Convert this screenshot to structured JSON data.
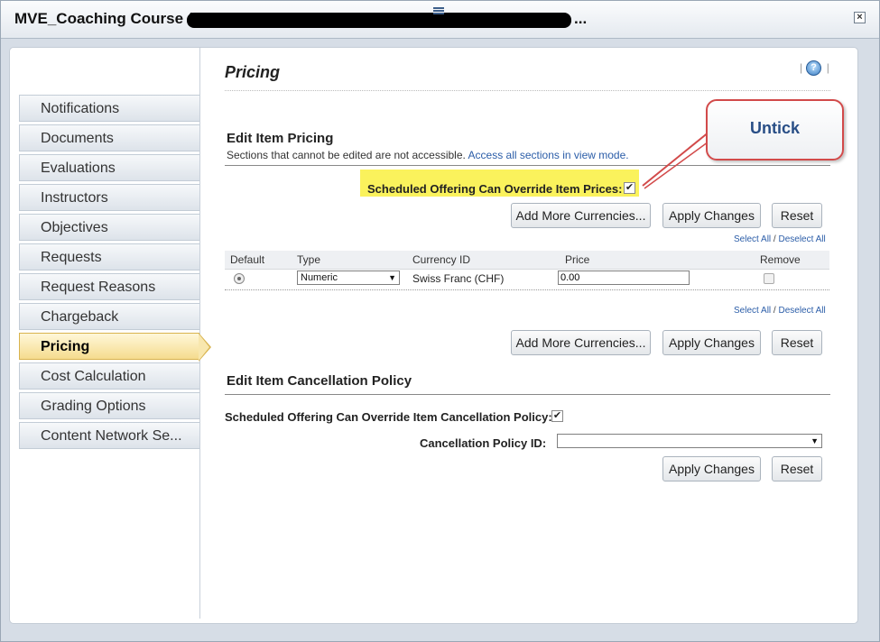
{
  "window": {
    "title": "MVE_Coaching Course (",
    "title_suffix": "...",
    "close_glyph": "×"
  },
  "sidebar": {
    "items": [
      {
        "label": "Notifications"
      },
      {
        "label": "Documents"
      },
      {
        "label": "Evaluations"
      },
      {
        "label": "Instructors"
      },
      {
        "label": "Objectives"
      },
      {
        "label": "Requests"
      },
      {
        "label": "Request Reasons"
      },
      {
        "label": "Chargeback"
      },
      {
        "label": "Pricing",
        "active": true
      },
      {
        "label": "Cost Calculation"
      },
      {
        "label": "Grading Options"
      },
      {
        "label": "Content Network Se..."
      }
    ]
  },
  "page": {
    "heading": "Pricing",
    "help_glyph": "?"
  },
  "item_pricing": {
    "title": "Edit Item Pricing",
    "note": "Sections that cannot be edited are not accessible.",
    "note_link": "Access all sections in view mode.",
    "override_label": "Scheduled Offering Can Override Item Prices:",
    "override_checked": "✔",
    "add_currencies": "Add More Currencies...",
    "apply_changes": "Apply Changes",
    "reset": "Reset",
    "select_all": "Select All",
    "separator": "/",
    "deselect_all": "Deselect All",
    "columns": [
      "Default",
      "Type",
      "Currency ID",
      "Price",
      "Remove"
    ],
    "rows": [
      {
        "type": "Numeric",
        "currency": "Swiss Franc (CHF)",
        "price": "0.00"
      }
    ]
  },
  "cancellation": {
    "title": "Edit Item Cancellation Policy",
    "override_label": "Scheduled Offering Can Override Item Cancellation Policy:",
    "override_checked": "✔",
    "policy_label": "Cancellation Policy ID:",
    "policy_value": "",
    "apply_changes": "Apply Changes",
    "reset": "Reset"
  },
  "callout": {
    "text": "Untick"
  },
  "colors": {
    "highlight": "#faf25c",
    "callout_border": "#d24a4a",
    "active_nav": "#f5dc8e",
    "link": "#2b5da8"
  }
}
